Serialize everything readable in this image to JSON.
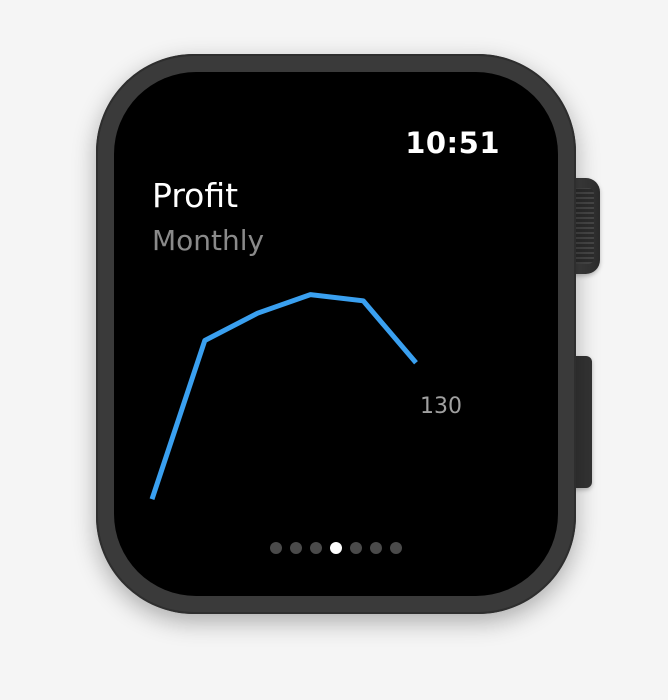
{
  "watch": {
    "time": "10:51",
    "title": "Profit",
    "subtitle": "Monthly",
    "last_value_label": "130"
  },
  "pager": {
    "count": 7,
    "active_index": 3
  },
  "colors": {
    "line": "#3aa0f0",
    "screen_bg": "#000000",
    "title": "#ffffff",
    "subtitle": "#8a8a8a"
  },
  "chart_data": {
    "type": "line",
    "title": "Profit",
    "subtitle": "Monthly",
    "x": [
      1,
      2,
      3,
      4,
      5,
      6
    ],
    "series": [
      {
        "values": [
          20,
          148,
          170,
          185,
          180,
          130
        ]
      }
    ],
    "ylim": [
      0,
      200
    ],
    "grid": false,
    "data_labels": [
      "130"
    ]
  }
}
